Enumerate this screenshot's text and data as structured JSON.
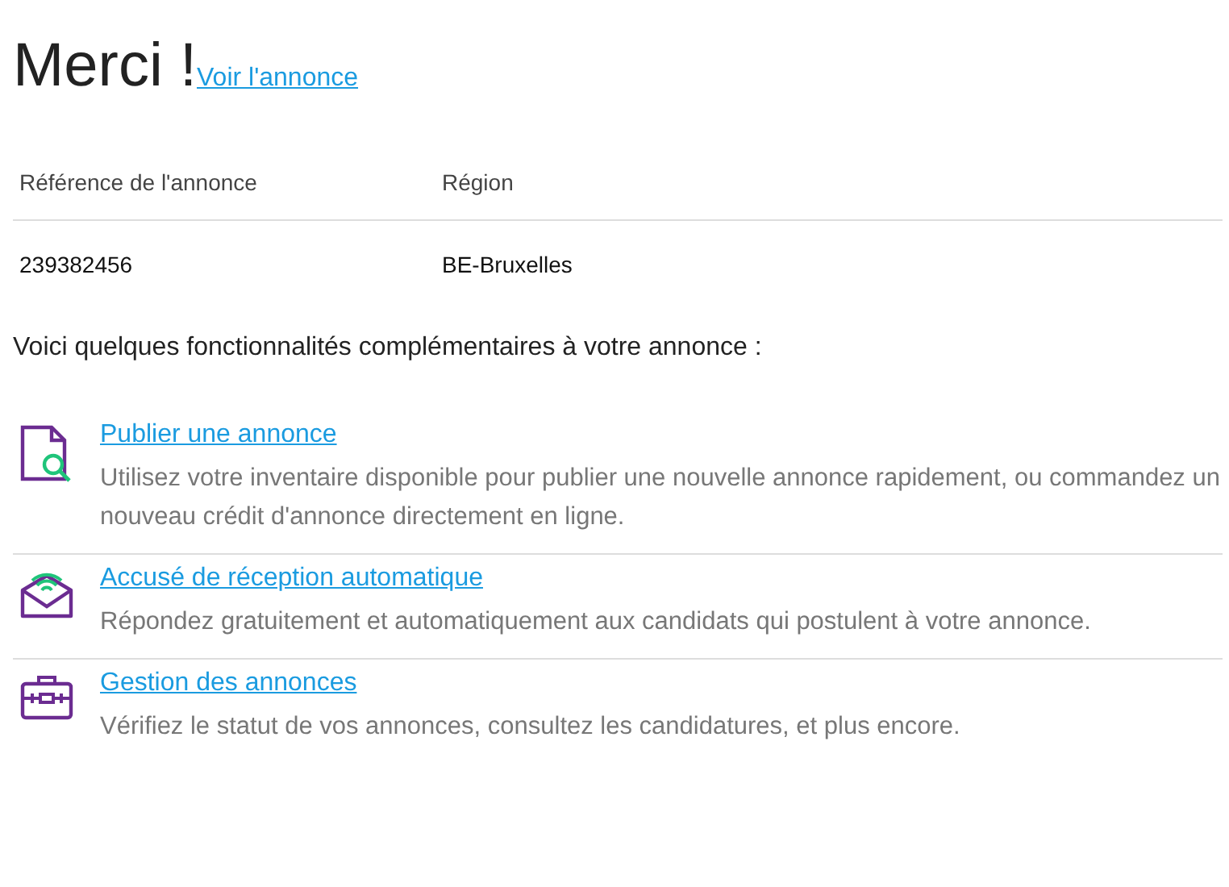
{
  "title": "Merci !",
  "view_link": "Voir l'annonce",
  "table": {
    "columns": [
      "Référence de l'annonce",
      "Région"
    ],
    "rows": [
      [
        "239382456",
        "BE-Bruxelles"
      ]
    ]
  },
  "intro": "Voici quelques fonctionnalités complémentaires à votre annonce :",
  "features": [
    {
      "kind": "publish",
      "title": "Publier une annonce",
      "description": "Utilisez votre inventaire disponible pour publier une nouvelle annonce rapidement, ou commandez un nouveau crédit d'annonce directement en ligne."
    },
    {
      "kind": "autoreply",
      "title": "Accusé de réception automatique",
      "description": "Répondez gratuitement et automatiquement aux candidats qui postulent à votre annonce."
    },
    {
      "kind": "manage",
      "title": "Gestion des annonces",
      "description": "Vérifiez le statut de vos annonces, consultez les candidatures, et plus encore."
    }
  ]
}
